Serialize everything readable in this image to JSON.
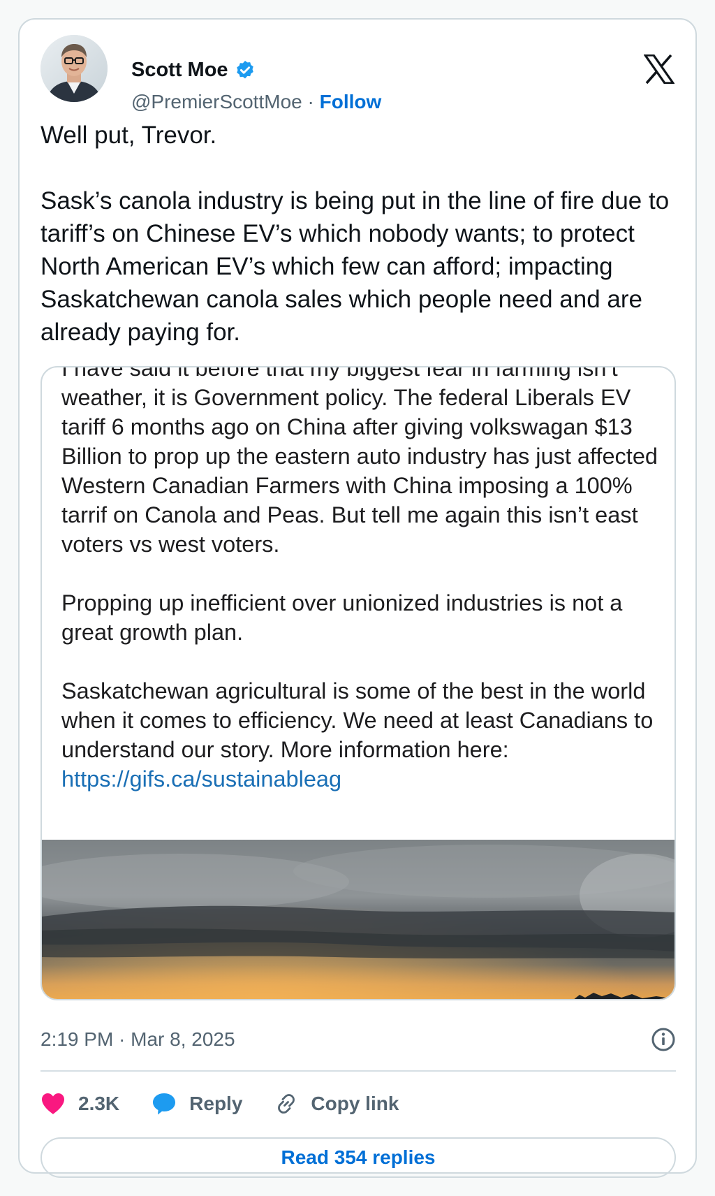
{
  "author": {
    "display_name": "Scott Moe",
    "handle": "@PremierScottMoe",
    "separator": " · ",
    "follow_label": "Follow",
    "verified_icon": "verified-badge-icon",
    "verified_color": "#1d9bf0"
  },
  "platform": {
    "logo_icon": "x-logo-icon"
  },
  "tweet": {
    "text": "Well put, Trevor.\n\nSask’s canola industry is being put in the line of fire due to tariff’s on Chinese EV’s which nobody wants; to protect North American EV’s which few can afford; impacting Saskatchewan canola sales which people need and are already paying for."
  },
  "embedded_post": {
    "paragraph_1": "I have said it before that my biggest fear in farming isn’t weather, it is Government policy. The federal Liberals EV tariff 6 months ago on China after giving volkswagan $13 Billion to prop up the eastern auto industry has just affected Western Canadian Farmers with China imposing a 100% tarrif on Canola and Peas. But tell me again this isn’t east voters vs west voters.",
    "paragraph_2": "Propping up inefficient over unionized industries is not a great growth plan.",
    "paragraph_3": "Saskatchewan agricultural is some of the best in the world when it comes to efficiency. We need at least Canadians to understand our story. More information here: ",
    "link": "https://gifs.ca/sustainableag"
  },
  "meta": {
    "timestamp": "2:19 PM · Mar 8, 2025",
    "info_icon": "info-icon"
  },
  "actions": {
    "like_count": "2.3K",
    "like_icon": "heart-icon",
    "like_color": "#f91880",
    "reply_label": "Reply",
    "reply_icon": "speech-bubble-icon",
    "reply_color": "#1d9bf0",
    "copy_link_label": "Copy link",
    "copy_link_icon": "link-icon"
  },
  "read_replies_label": "Read 354 replies",
  "colors": {
    "link_blue": "#006fd6",
    "secondary_text": "#536471",
    "border": "#cfd9de"
  }
}
